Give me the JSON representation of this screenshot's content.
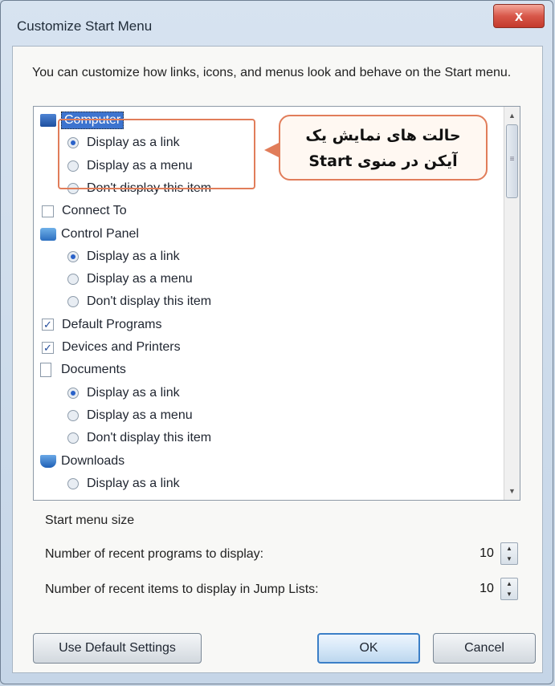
{
  "window": {
    "title": "Customize Start Menu",
    "close_label": "x"
  },
  "description": "You can customize how links, icons, and menus look and behave on the Start menu.",
  "callout": {
    "line1": "حالت های نمایش یک",
    "line2": "آیکن در منوی Start"
  },
  "list_items": [
    {
      "type": "header",
      "label": "Computer",
      "icon": "computer-icon"
    },
    {
      "type": "radio",
      "label": "Display as a link",
      "checked": true
    },
    {
      "type": "radio",
      "label": "Display as a menu",
      "checked": false
    },
    {
      "type": "radio",
      "label": "Don't display this item",
      "checked": false
    },
    {
      "type": "checkbox",
      "label": "Connect To",
      "checked": false
    },
    {
      "type": "header",
      "label": "Control Panel",
      "icon": "control-panel-icon"
    },
    {
      "type": "radio",
      "label": "Display as a link",
      "checked": true
    },
    {
      "type": "radio",
      "label": "Display as a menu",
      "checked": false
    },
    {
      "type": "radio",
      "label": "Don't display this item",
      "checked": false
    },
    {
      "type": "checkbox",
      "label": "Default Programs",
      "checked": true
    },
    {
      "type": "checkbox",
      "label": "Devices and Printers",
      "checked": true
    },
    {
      "type": "header",
      "label": "Documents",
      "icon": "documents-icon"
    },
    {
      "type": "radio",
      "label": "Display as a link",
      "checked": true
    },
    {
      "type": "radio",
      "label": "Display as a menu",
      "checked": false
    },
    {
      "type": "radio",
      "label": "Don't display this item",
      "checked": false
    },
    {
      "type": "header",
      "label": "Downloads",
      "icon": "downloads-icon"
    },
    {
      "type": "radio",
      "label": "Display as a link",
      "checked": false
    }
  ],
  "start_menu_size": {
    "label": "Start menu size",
    "recent_programs_label": "Number of recent programs to display:",
    "recent_programs_value": "10",
    "jump_list_label": "Number of recent items to display in Jump Lists:",
    "jump_list_value": "10"
  },
  "buttons": {
    "defaults": "Use Default Settings",
    "ok": "OK",
    "cancel": "Cancel"
  }
}
